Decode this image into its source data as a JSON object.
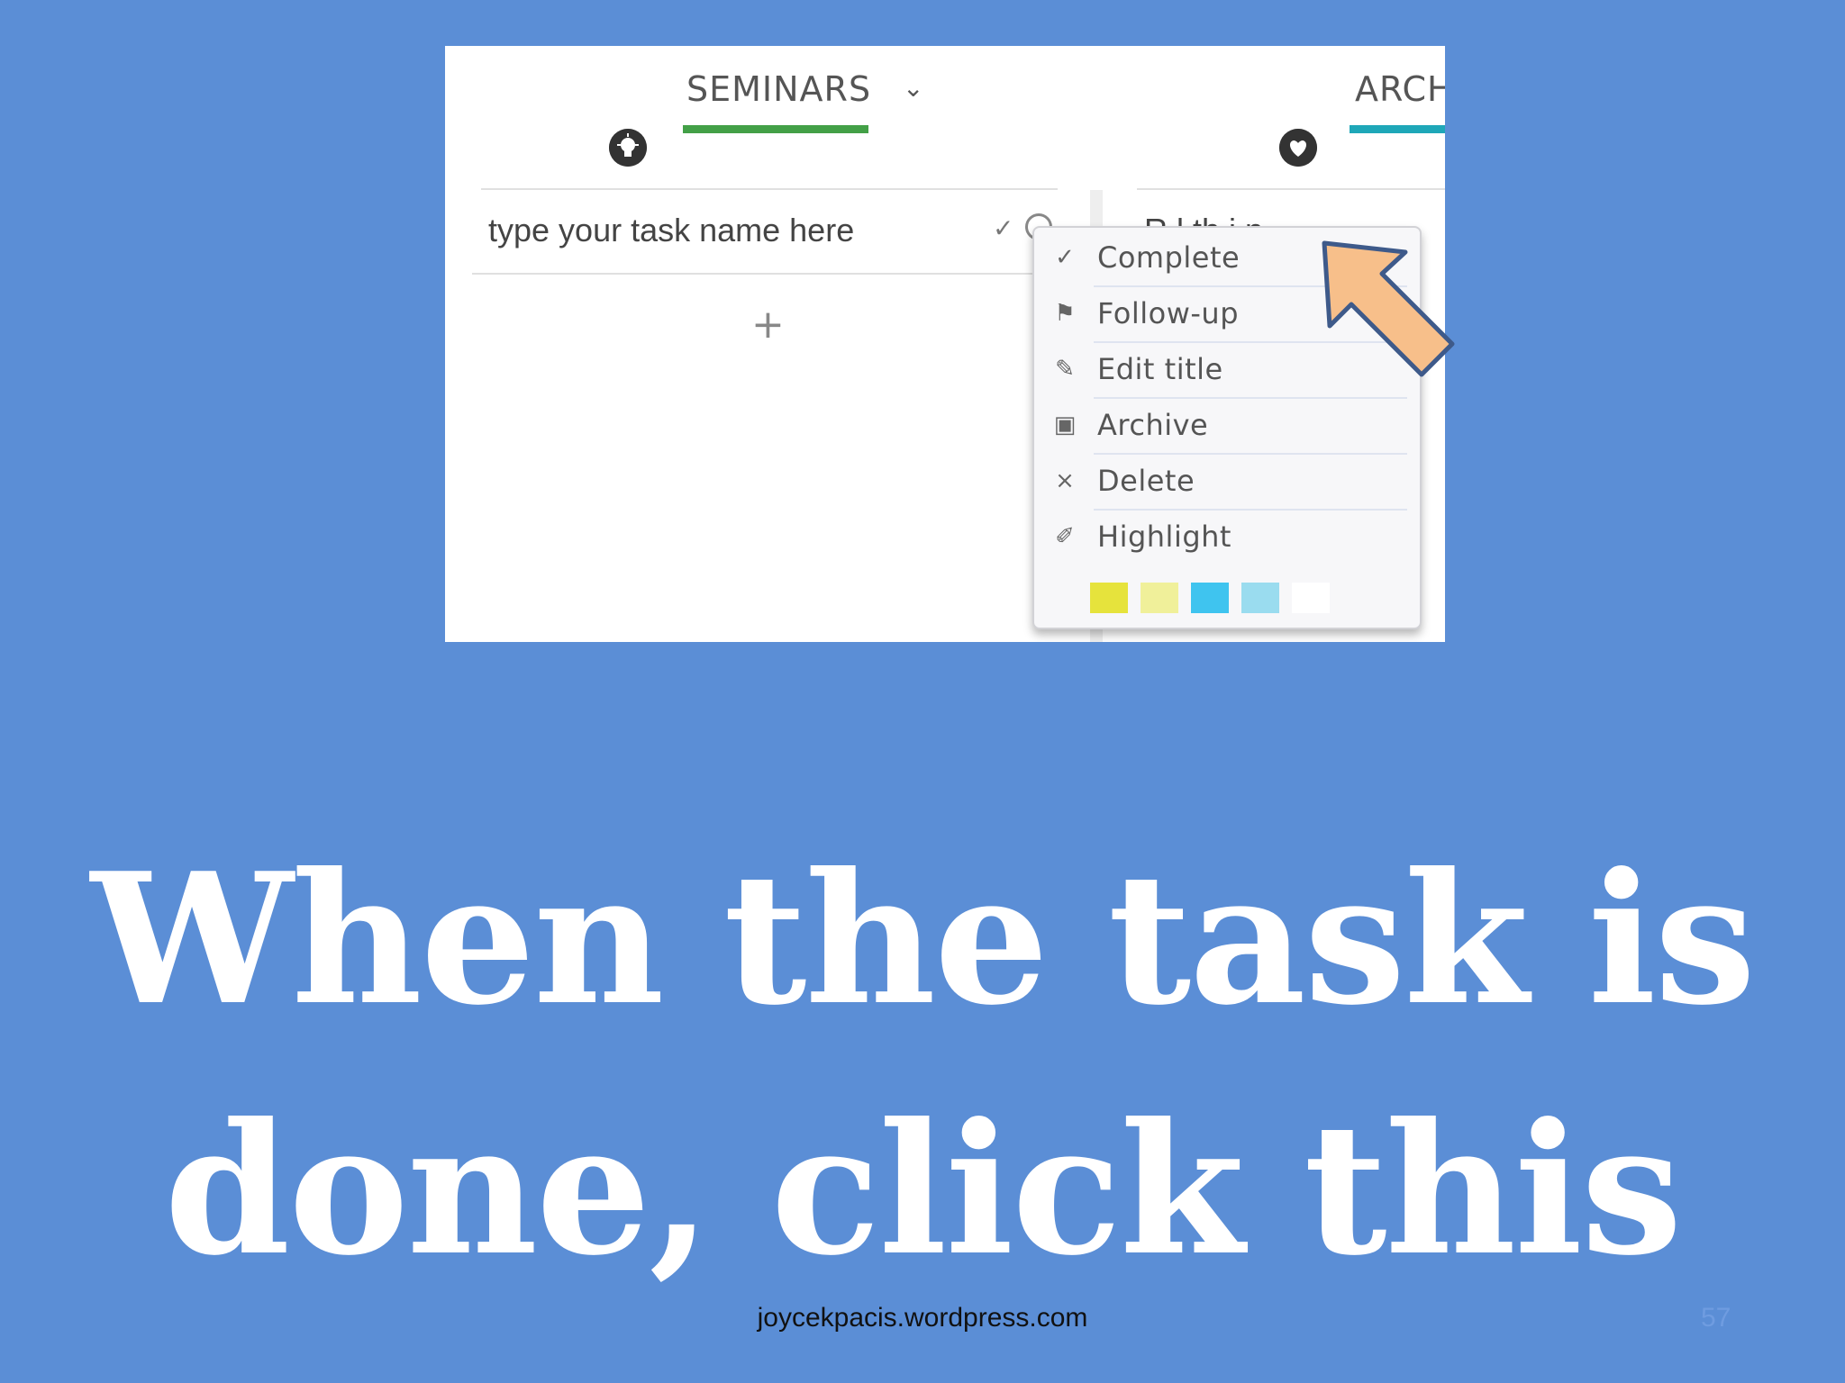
{
  "screenshot": {
    "tabs": [
      {
        "label": "SEMINARS",
        "icon": "lightbulb-icon",
        "underline_color": "#43a047"
      },
      {
        "label": "ARCH",
        "icon": "heart-icon",
        "underline_color": "#1ea7b8"
      }
    ],
    "task": {
      "placeholder": "type your task name here",
      "second_column_text": "R    l    th       i  n"
    },
    "add_icon": "plus-icon",
    "context_menu": {
      "items": [
        {
          "label": "Complete",
          "icon": "check-icon"
        },
        {
          "label": "Follow-up",
          "icon": "flag-icon"
        },
        {
          "label": "Edit title",
          "icon": "pencil-icon"
        },
        {
          "label": "Archive",
          "icon": "archive-icon"
        },
        {
          "label": "Delete",
          "icon": "close-icon"
        },
        {
          "label": "Highlight",
          "icon": "highlighter-icon"
        }
      ],
      "highlight_colors": [
        "#e6e33c",
        "#f0f09a",
        "#3fc4ef",
        "#9adcef",
        "#ffffff"
      ]
    },
    "callout_arrow_color": "#f7bf8a"
  },
  "headline": {
    "line1": "When the task is",
    "line2": "done, click this"
  },
  "footer": {
    "url": "joycekpacis.wordpress.com",
    "page_number": "57"
  }
}
